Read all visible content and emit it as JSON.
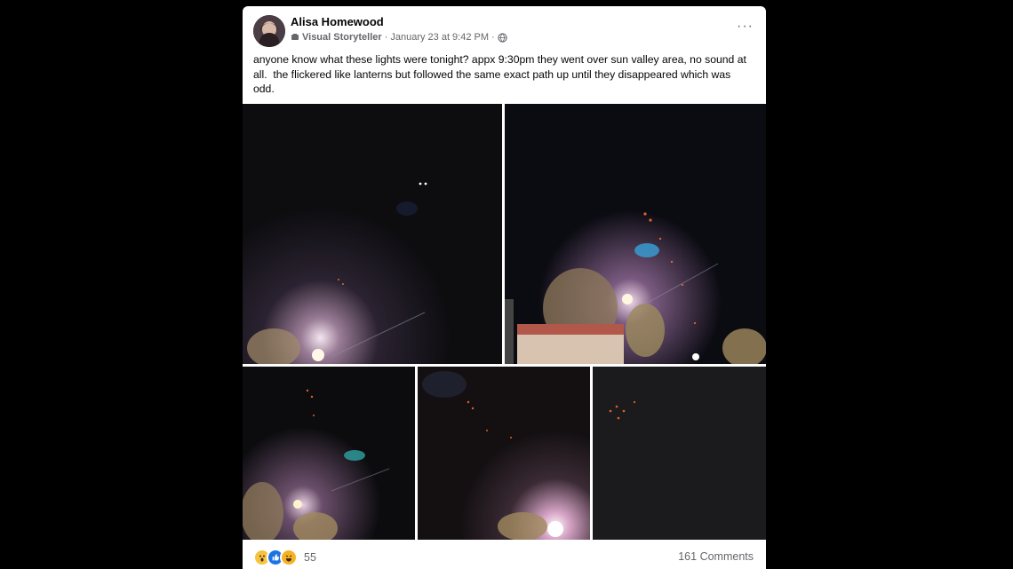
{
  "post": {
    "author": "Alisa Homewood",
    "role": "Visual Storyteller",
    "separator": "·",
    "timestamp": "January 23 at 9:42 PM",
    "separator2": "·",
    "text": "anyone know what these lights were tonight? appx 9:30pm they went over sun valley area, no sound at all.  the flickered like lanterns but followed the same exact path up until they disappeared which was odd.",
    "more_label": "···"
  },
  "footer": {
    "reaction_count": "55",
    "comments_label": "161 Comments"
  },
  "icons": {
    "visibility": "globe-icon",
    "badge": "visual-storyteller-badge-icon",
    "reactions": [
      "wow-reaction-icon",
      "like-reaction-icon",
      "haha-reaction-icon"
    ]
  },
  "colors": {
    "background": "#000000",
    "card": "#ffffff",
    "meta_text": "#65676b",
    "like_blue": "#1b74e4"
  }
}
